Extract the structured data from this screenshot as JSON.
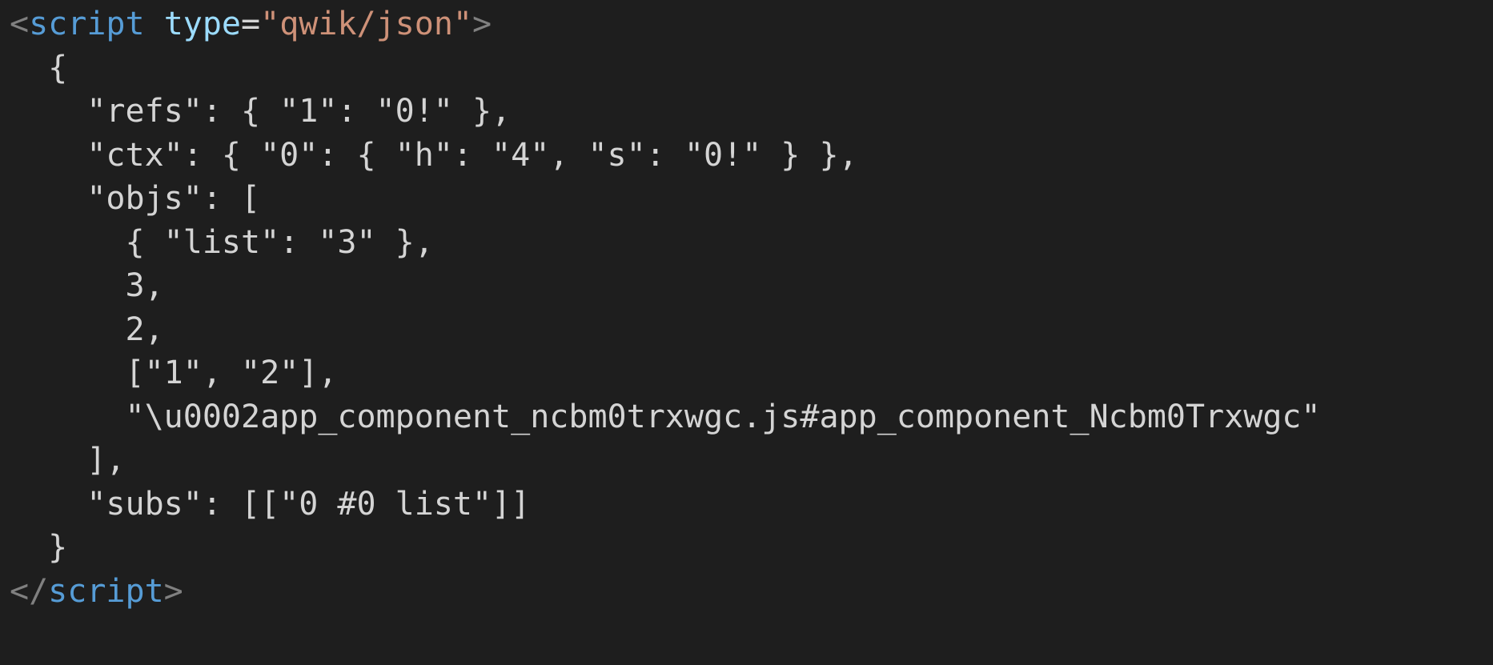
{
  "editor": {
    "theme_colors": {
      "background": "#1e1e1e",
      "plain_text": "#d4d4d4",
      "tag_bracket": "#808080",
      "tag_name": "#569cd6",
      "attribute_name": "#9cdcfe",
      "attribute_value": "#ce9178"
    },
    "lines": [
      [
        "<",
        "script",
        " ",
        "type",
        "=",
        "\"qwik/json\"",
        ">"
      ],
      [
        "  {"
      ],
      [
        "    \"refs\": { \"1\": \"0!\" },"
      ],
      [
        "    \"ctx\": { \"0\": { \"h\": \"4\", \"s\": \"0!\" } },"
      ],
      [
        "    \"objs\": ["
      ],
      [
        "      { \"list\": \"3\" },"
      ],
      [
        "      3,"
      ],
      [
        "      2,"
      ],
      [
        "      [\"1\", \"2\"],"
      ],
      [
        "      \"\\u0002app_component_ncbm0trxwgc.js#app_component_Ncbm0Trxwgc\""
      ],
      [
        "    ],"
      ],
      [
        "    \"subs\": [[\"0 #0 list\"]]"
      ],
      [
        "  }"
      ],
      [
        "</",
        "script",
        ">"
      ]
    ]
  }
}
